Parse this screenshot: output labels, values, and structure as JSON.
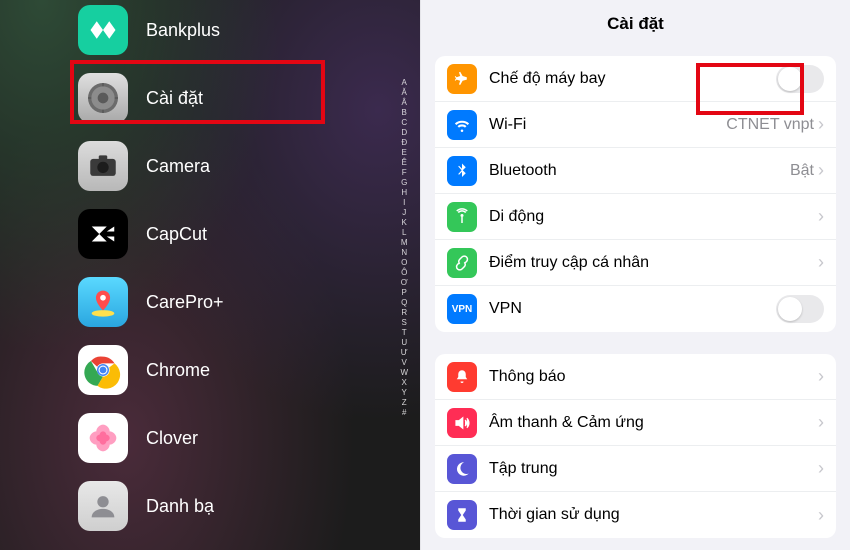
{
  "left": {
    "apps": [
      {
        "id": "bankplus",
        "label": "Bankplus",
        "icon": "bankplus-icon"
      },
      {
        "id": "settings",
        "label": "Cài đặt",
        "icon": "settings-icon"
      },
      {
        "id": "camera",
        "label": "Camera",
        "icon": "camera-icon"
      },
      {
        "id": "capcut",
        "label": "CapCut",
        "icon": "capcut-icon"
      },
      {
        "id": "carepro",
        "label": "CarePro+",
        "icon": "carepro-icon"
      },
      {
        "id": "chrome",
        "label": "Chrome",
        "icon": "chrome-icon"
      },
      {
        "id": "clover",
        "label": "Clover",
        "icon": "clover-icon"
      },
      {
        "id": "contacts",
        "label": "Danh bạ",
        "icon": "contacts-icon"
      }
    ],
    "index_letters": [
      "A",
      "Ă",
      "Â",
      "B",
      "C",
      "D",
      "Đ",
      "E",
      "Ê",
      "F",
      "G",
      "H",
      "I",
      "J",
      "K",
      "L",
      "M",
      "N",
      "O",
      "Ô",
      "Ơ",
      "P",
      "Q",
      "R",
      "S",
      "T",
      "U",
      "Ư",
      "V",
      "W",
      "X",
      "Y",
      "Z",
      "#"
    ]
  },
  "right": {
    "title": "Cài đặt",
    "group1": [
      {
        "id": "airplane",
        "label": "Chế độ máy bay",
        "icon": "airplane-icon",
        "color": "c-orange",
        "trailing": "toggle",
        "toggle_on": false
      },
      {
        "id": "wifi",
        "label": "Wi-Fi",
        "icon": "wifi-icon",
        "color": "c-blue",
        "trailing": "value-chevron",
        "value": "CTNET vnpt"
      },
      {
        "id": "bluetooth",
        "label": "Bluetooth",
        "icon": "bluetooth-icon",
        "color": "c-blue",
        "trailing": "value-chevron",
        "value": "Bật"
      },
      {
        "id": "cellular",
        "label": "Di động",
        "icon": "antenna-icon",
        "color": "c-green",
        "trailing": "chevron"
      },
      {
        "id": "hotspot",
        "label": "Điểm truy cập cá nhân",
        "icon": "link-icon",
        "color": "c-green",
        "trailing": "chevron"
      },
      {
        "id": "vpn",
        "label": "VPN",
        "icon": "vpn-icon",
        "color": "c-vpn",
        "trailing": "toggle",
        "toggle_on": false
      }
    ],
    "group2": [
      {
        "id": "notifications",
        "label": "Thông báo",
        "icon": "bell-icon",
        "color": "c-red",
        "trailing": "chevron"
      },
      {
        "id": "sounds",
        "label": "Âm thanh & Cảm ứng",
        "icon": "speaker-icon",
        "color": "c-pink",
        "trailing": "chevron"
      },
      {
        "id": "focus",
        "label": "Tập trung",
        "icon": "moon-icon",
        "color": "c-purple",
        "trailing": "chevron"
      },
      {
        "id": "screentime",
        "label": "Thời gian sử dụng",
        "icon": "hourglass-icon",
        "color": "c-teal",
        "trailing": "chevron"
      }
    ]
  },
  "highlights": {
    "left_app": "settings",
    "right_row": "airplane"
  }
}
